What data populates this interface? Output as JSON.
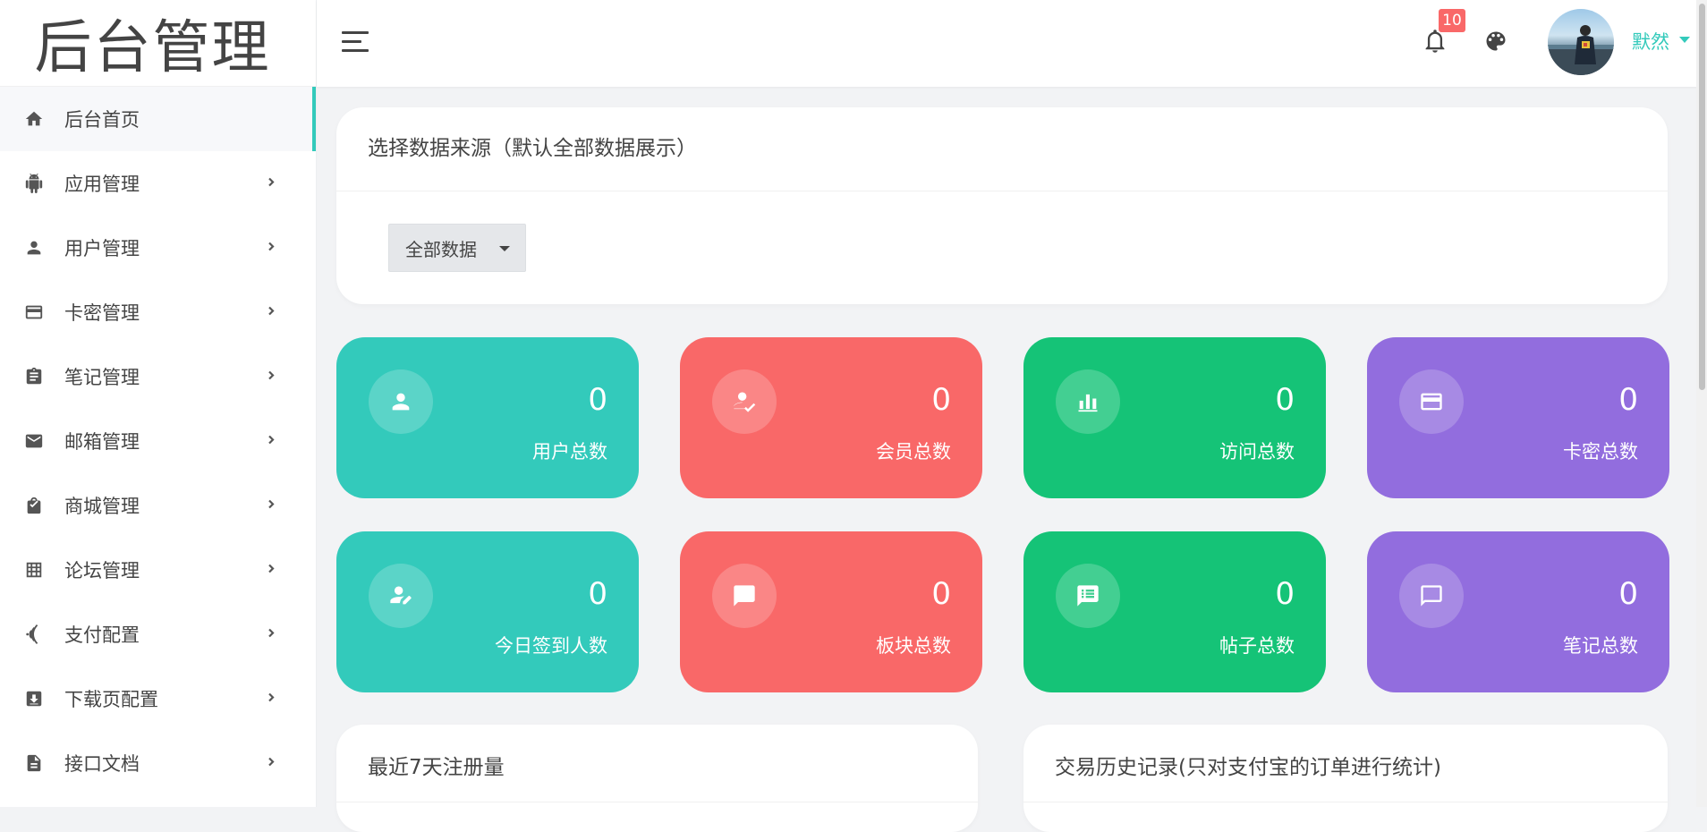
{
  "brand": {
    "title": "后台管理"
  },
  "sidebar": {
    "items": [
      {
        "label": "后台首页",
        "icon": "home-icon",
        "active": true
      },
      {
        "label": "应用管理",
        "icon": "android-icon"
      },
      {
        "label": "用户管理",
        "icon": "user-icon"
      },
      {
        "label": "卡密管理",
        "icon": "card-icon"
      },
      {
        "label": "笔记管理",
        "icon": "clipboard-icon"
      },
      {
        "label": "邮箱管理",
        "icon": "mail-icon"
      },
      {
        "label": "商城管理",
        "icon": "shopping-bag-icon"
      },
      {
        "label": "论坛管理",
        "icon": "grid-table-icon"
      },
      {
        "label": "支付配置",
        "icon": "nfc-icon"
      },
      {
        "label": "下载页配置",
        "icon": "download-box-icon"
      },
      {
        "label": "接口文档",
        "icon": "document-icon"
      }
    ]
  },
  "header": {
    "notification_count": "10",
    "username": "默然"
  },
  "filter": {
    "title": "选择数据来源（默认全部数据展示）",
    "dropdown_label": "全部数据"
  },
  "stats": [
    {
      "value": "0",
      "label": "用户总数",
      "icon": "user-icon",
      "color": "#33cabb"
    },
    {
      "value": "0",
      "label": "会员总数",
      "icon": "user-check-icon",
      "color": "#f96868"
    },
    {
      "value": "0",
      "label": "访问总数",
      "icon": "bar-chart-icon",
      "color": "#15c377"
    },
    {
      "value": "0",
      "label": "卡密总数",
      "icon": "card-icon",
      "color": "#926dde"
    },
    {
      "value": "0",
      "label": "今日签到人数",
      "icon": "user-edit-icon",
      "color": "#33cabb"
    },
    {
      "value": "0",
      "label": "板块总数",
      "icon": "message-icon",
      "color": "#f96868"
    },
    {
      "value": "0",
      "label": "帖子总数",
      "icon": "message-text-icon",
      "color": "#15c377"
    },
    {
      "value": "0",
      "label": "笔记总数",
      "icon": "message-outline-icon",
      "color": "#926dde"
    }
  ],
  "panels": {
    "registrations_title": "最近7天注册量",
    "transactions_title": "交易历史记录(只对支付宝的订单进行统计)"
  }
}
